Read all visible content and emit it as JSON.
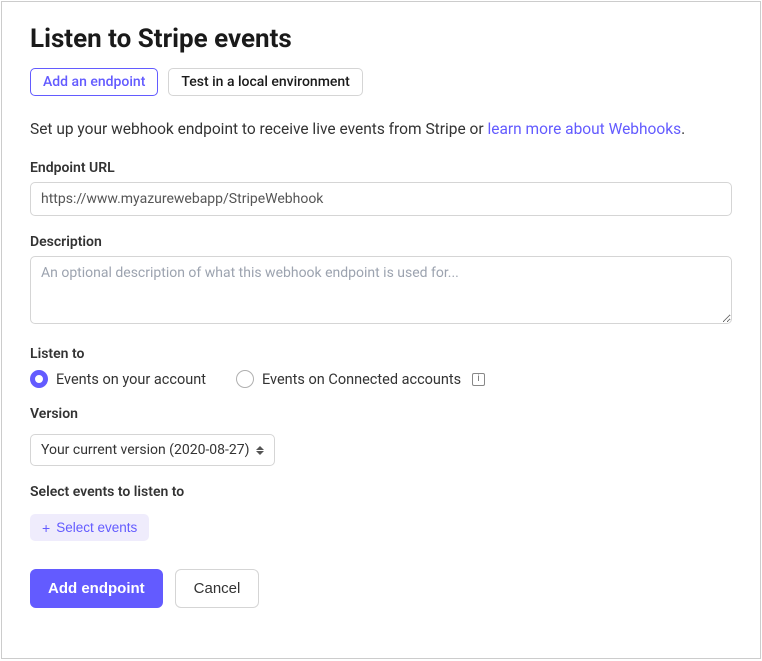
{
  "title": "Listen to Stripe events",
  "tabs": {
    "add_endpoint": "Add an endpoint",
    "test_local": "Test in a local environment"
  },
  "intro": {
    "prefix": "Set up your webhook endpoint to receive live events from Stripe or ",
    "link": "learn more about Webhooks",
    "suffix": "."
  },
  "endpoint_url": {
    "label": "Endpoint URL",
    "value": "https://www.myazurewebapp/StripeWebhook"
  },
  "description": {
    "label": "Description",
    "placeholder": "An optional description of what this webhook endpoint is used for..."
  },
  "listen_to": {
    "label": "Listen to",
    "option_account": "Events on your account",
    "option_connected": "Events on Connected accounts"
  },
  "version": {
    "label": "Version",
    "selected": "Your current version (2020-08-27)"
  },
  "select_events": {
    "label": "Select events to listen to",
    "button": "Select events"
  },
  "actions": {
    "add": "Add endpoint",
    "cancel": "Cancel"
  },
  "info_glyph": "i"
}
